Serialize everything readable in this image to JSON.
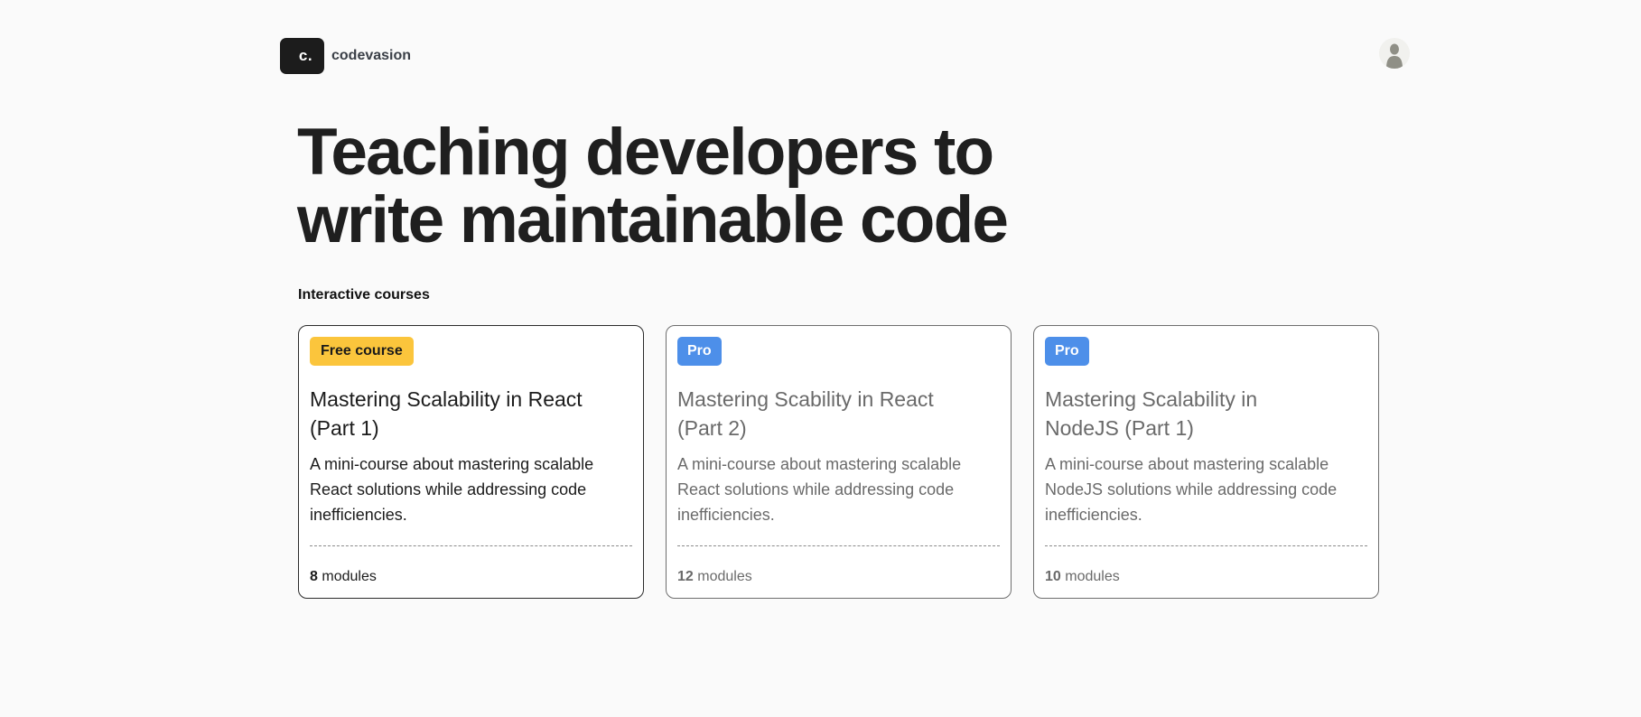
{
  "header": {
    "logo_text": "c.",
    "brand_name": "codevasion",
    "avatar_icon": "user-avatar-icon"
  },
  "hero": {
    "title_line1": "Teaching developers to",
    "title_line2": "write maintainable code"
  },
  "section": {
    "label": "Interactive courses"
  },
  "courses": [
    {
      "badge": "Free course",
      "badge_type": "free",
      "title_line1": "Mastering Scalability in React",
      "title_line2": "(Part 1)",
      "description": "A mini-course about mastering scalable React solutions while addressing code inefficiencies.",
      "module_count": "8",
      "module_label": "modules"
    },
    {
      "badge": "Pro",
      "badge_type": "pro",
      "title_line1": "Mastering Scability in React",
      "title_line2": "(Part 2)",
      "description": "A mini-course about mastering scalable React solutions while addressing code inefficiencies.",
      "module_count": "12",
      "module_label": "modules"
    },
    {
      "badge": "Pro",
      "badge_type": "pro",
      "title_line1": "Mastering Scalability in",
      "title_line2": "NodeJS (Part 1)",
      "description": "A mini-course about mastering scalable NodeJS solutions while addressing code inefficiencies.",
      "module_count": "10",
      "module_label": "modules"
    }
  ],
  "colors": {
    "background": "#fafafa",
    "free_badge": "#fbc53c",
    "pro_badge": "#4d8fe9",
    "logo_bg": "#1c1c1c"
  }
}
